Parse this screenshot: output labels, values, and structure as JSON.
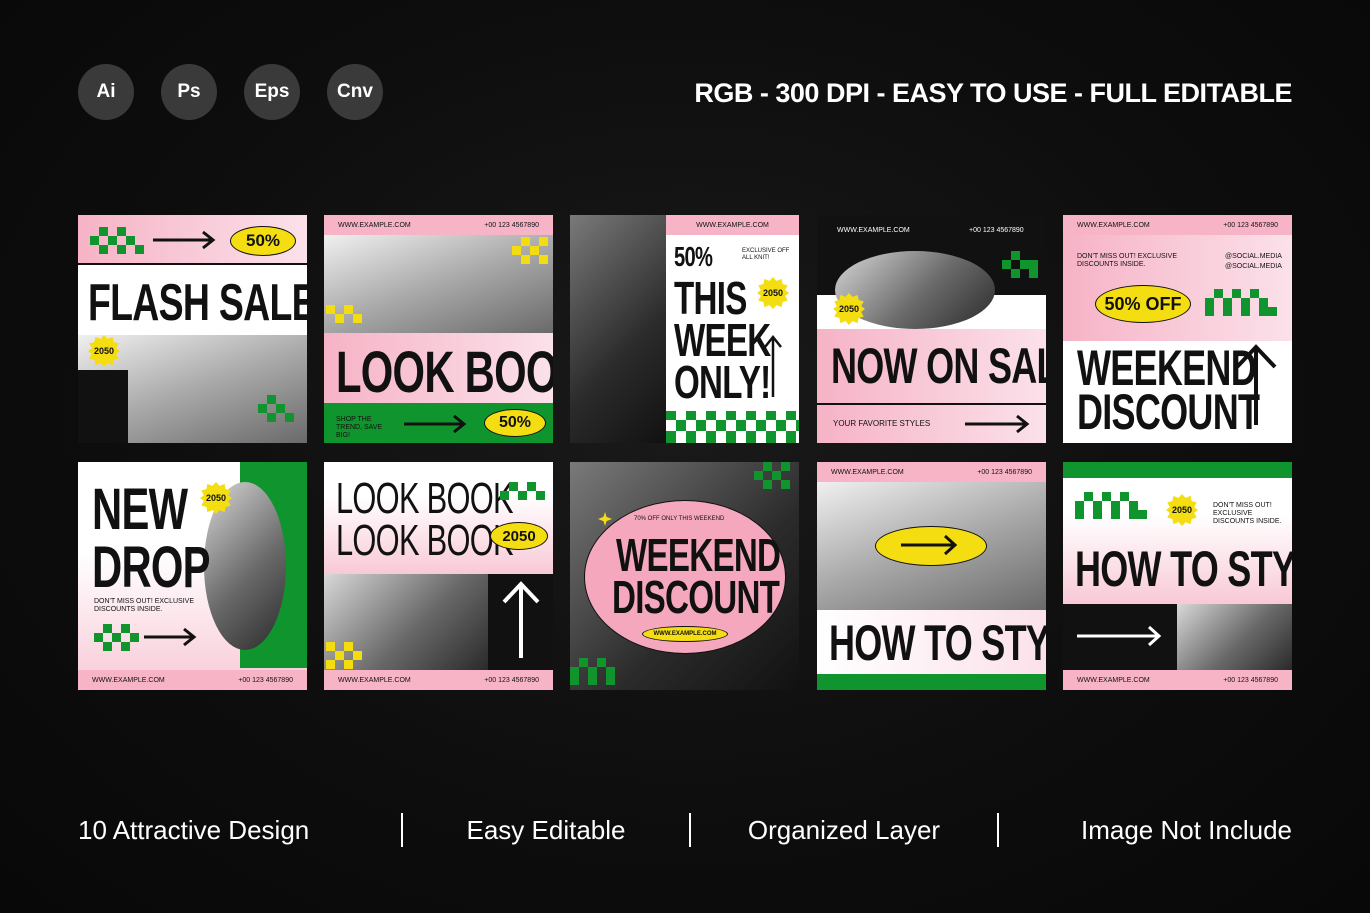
{
  "badges": [
    "Ai",
    "Ps",
    "Eps",
    "Cnv"
  ],
  "headline": "RGB - 300 DPI - EASY TO USE - FULL EDITABLE",
  "common": {
    "website": "WWW.EXAMPLE.COM",
    "phone": "+00 123 4567890",
    "year": "2050",
    "social": "@SOCIAL.MEDIA"
  },
  "cards": {
    "c1": {
      "title": "FLASH SALE",
      "pct": "50%"
    },
    "c2": {
      "title": "LOOK BOOK",
      "tagline": "SHOP THE TREND, SAVE BIG!",
      "pct": "50%"
    },
    "c3": {
      "pct": "50%",
      "line1": "THIS",
      "line2": "WEEK",
      "line3": "ONLY!",
      "note": "EXCLUSIVE OFF ALL KNIT!"
    },
    "c4": {
      "title": "NOW ON SALE",
      "tagline": "YOUR FAVORITE STYLES"
    },
    "c5": {
      "off": "50% OFF",
      "line1": "WEEKEND",
      "line2": "DISCOUNT",
      "note": "DON'T MISS OUT! EXCLUSIVE DISCOUNTS INSIDE."
    },
    "c6": {
      "line1": "NEW",
      "line2": "DROP",
      "note": "DON'T MISS OUT! EXCLUSIVE DISCOUNTS INSIDE."
    },
    "c7": {
      "line1": "LOOK BOOK",
      "line2": "LOOK BOOK"
    },
    "c8": {
      "line1": "WEEKEND",
      "line2": "DISCOUNT",
      "note": "70% OFF ONLY THIS WEEKEND"
    },
    "c9": {
      "title": "HOW TO STYLE"
    },
    "c10": {
      "title": "HOW TO STYLE",
      "note": "DON'T MISS OUT! EXCLUSIVE DISCOUNTS INSIDE."
    }
  },
  "footer": [
    "10 Attractive Design",
    "Easy Editable",
    "Organized Layer",
    "Image Not Include"
  ]
}
